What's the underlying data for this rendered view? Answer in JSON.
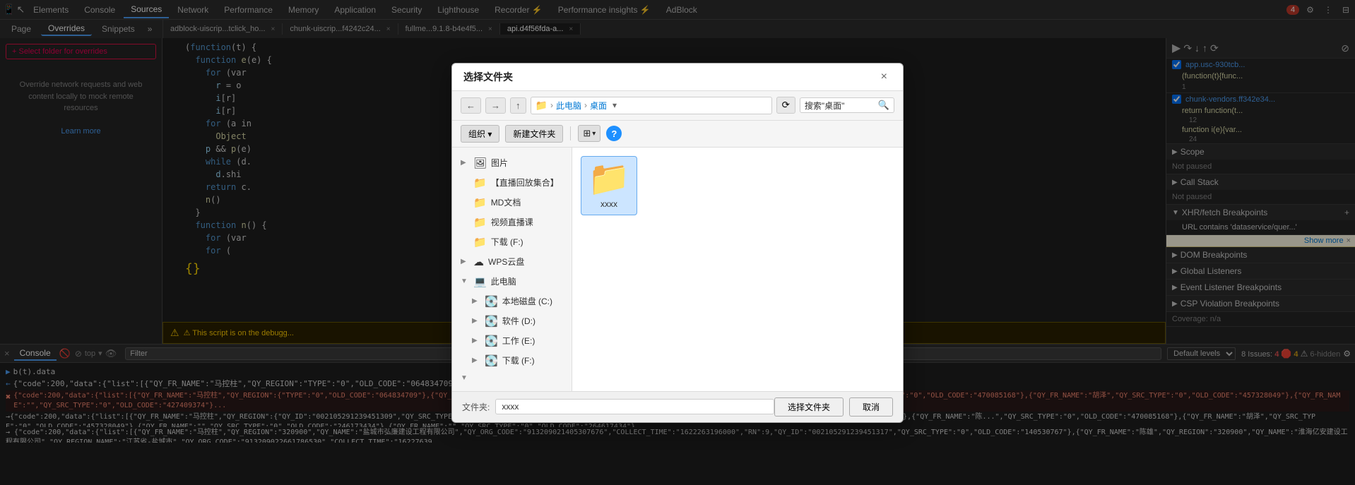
{
  "tabs": {
    "items": [
      {
        "label": "Elements",
        "active": false
      },
      {
        "label": "Console",
        "active": false
      },
      {
        "label": "Sources",
        "active": true
      },
      {
        "label": "Network",
        "active": false
      },
      {
        "label": "Performance",
        "active": false
      },
      {
        "label": "Memory",
        "active": false
      },
      {
        "label": "Application",
        "active": false
      },
      {
        "label": "Security",
        "active": false
      },
      {
        "label": "Lighthouse",
        "active": false
      },
      {
        "label": "Recorder ⚡",
        "active": false
      },
      {
        "label": "Performance insights ⚡",
        "active": false
      },
      {
        "label": "AdBlock",
        "active": false
      }
    ],
    "issue_count": "4",
    "settings_icon": "⚙",
    "more_icon": "⋮",
    "dock_icon": "⊟",
    "undock_icon": "⊞"
  },
  "subtabs": {
    "items": [
      {
        "label": "Page",
        "active": false
      },
      {
        "label": "Overrides",
        "active": true
      },
      {
        "label": "Snippets",
        "active": false
      }
    ],
    "more": "»",
    "menu_icon": "⋮"
  },
  "sidebar": {
    "select_folder_label": "+ Select folder for overrides",
    "info_text": "Override network requests and web content locally to mock remote resources",
    "learn_more": "Learn more"
  },
  "file_tabs": [
    {
      "label": "adblock-uiscrip...tclick_ho...",
      "active": false,
      "closable": true
    },
    {
      "label": "chunk-uiscrip...f4242c24...",
      "active": false,
      "closable": true
    },
    {
      "label": "fullme...9.1.8-b4e4f5...",
      "active": false,
      "closable": true
    },
    {
      "label": "api.d4f56fda-a...",
      "active": true,
      "closable": true
    }
  ],
  "code_lines": [
    {
      "num": "",
      "content": "(function(t) {"
    },
    {
      "num": "",
      "content": "  function e(e) {"
    },
    {
      "num": "",
      "content": "    for (var"
    },
    {
      "num": "",
      "content": "      r = o"
    },
    {
      "num": "",
      "content": "      i[r]"
    },
    {
      "num": "",
      "content": "      i[r]"
    },
    {
      "num": "",
      "content": "    for (a in"
    },
    {
      "num": "",
      "content": "      Object"
    },
    {
      "num": "",
      "content": "    p && p(e)"
    },
    {
      "num": "",
      "content": "    while (d."
    },
    {
      "num": "",
      "content": "      d.shi"
    },
    {
      "num": "",
      "content": "    return c."
    },
    {
      "num": "",
      "content": "    n()"
    },
    {
      "num": "",
      "content": "  }"
    },
    {
      "num": "",
      "content": "  function n() {"
    },
    {
      "num": "",
      "content": "    for (var"
    },
    {
      "num": "",
      "content": "    for ("
    }
  ],
  "debug_banner": "⚠ This script is on the debugg...",
  "right_panel": {
    "scope_label": "Scope",
    "scope_status": "Not paused",
    "callstack_label": "Call Stack",
    "callstack_status": "Not paused",
    "xhr_label": "XHR/fetch Breakpoints",
    "url_contains_label": "URL contains 'dataservice/quer...'",
    "dom_label": "DOM Breakpoints",
    "global_label": "Global Listeners",
    "event_label": "Event Listener Breakpoints",
    "csp_label": "CSP Violation Breakpoints",
    "file_items": [
      {
        "name": "app.usc-930tcb...",
        "checked": true,
        "line": 1,
        "fn": "(function(t){func..."
      },
      {
        "name": "chunk-vendors.ff342e34...",
        "checked": true,
        "lines": [
          12,
          24
        ]
      },
      {
        "fn1": "return function(t...",
        "line1": 12
      },
      {
        "fn2": "function i(e){var...",
        "line2": 24
      }
    ],
    "show_more": "Show more",
    "coverage": "Coverage: n/a"
  },
  "console": {
    "tab_label": "Console",
    "filter_placeholder": "Filter",
    "level_label": "Default levels",
    "issues_label": "8 Issues:",
    "issues_count": "4",
    "issues_warn": "4",
    "issues_hidden": "6-hidden",
    "line1": "b(t).data",
    "line2": "{\"code\":200,\"data\":{\"list\":[{\"QY_FR_NAME\":\"马控柱\",\"QY_REGION\":{\"TYPE\":\"0\",\"OLD_CODE\":\"064834709\"},{\"QY_FR_NAME\":\"郭伟其\",\"QY_REG...",
    "line3_red": "{\"code\":200,\"data\":{\"list\":[{\"QY_FR_NAME\":\"马控柱\",\"QY_REGION\":\"TYPE\":\"0\",\"OLD_CODE\":\"064834709\"},{\"QY_FR_NAME\":\"郭伟其\"...",
    "long_data": "→ {\"code\":200,\"data\":{\"list\":[{\"QY_FR_NAME\":\"马控柱\",\"QY_REGION\":{\"TYPE\":\"0\",\"OLD_CODE\":\"064834709\"},{\"QY_FR_NAME\":\"郭伟其\",\"QY_REG:\"425030769\"},{\"QY_FR_NAME\":\"陈...\",\"QY_SRC_TYPE\":\"0\",\"OLD_CODE\":\"470085168\"},{\"QY_FR_NAME\":\"\",\"QY_SRC_TYPE\":\"0\",\"OLD_CODE\":\"457328049\"},{\"QY_FR_NAME\":\"胡泽\",\"QY_SRC_TYPE\":\"0\",\"OLD_CODE\":\"427409374\"},{\"QY_FR_NAME\":\"元...\",\"QY_SRC_TYPE\":\"0\",\"OLD_CODE\":\"246173434\"},{\"QY_SRC_TYPE\":\"0\",\"OLD_CODE\":\"264617434\"},{\"QY_FR_NAME\":\""
  },
  "dialog": {
    "title": "选择文件夹",
    "close_btn": "×",
    "breadcrumb": [
      "此电脑",
      "桌面"
    ],
    "search_placeholder": "搜索\"桌面\"",
    "organize_label": "组织 ▾",
    "new_folder_label": "新建文件夹",
    "sidebar_items": [
      {
        "label": "图片",
        "icon": "🖼",
        "arrow": "▶",
        "indent": false
      },
      {
        "label": "【直播回放集合】",
        "icon": "📁",
        "arrow": "",
        "indent": false
      },
      {
        "label": "MD文档",
        "icon": "📁",
        "arrow": "",
        "indent": false
      },
      {
        "label": "视频直播课",
        "icon": "📁",
        "arrow": "",
        "indent": false
      },
      {
        "label": "下载 (F:)",
        "icon": "📁",
        "arrow": "",
        "indent": false
      },
      {
        "label": "WPS云盘",
        "icon": "☁",
        "arrow": "▶",
        "indent": false
      },
      {
        "label": "此电脑",
        "icon": "💻",
        "arrow": "▼",
        "indent": false
      },
      {
        "label": "本地磁盘 (C:)",
        "icon": "💽",
        "arrow": "▶",
        "indent": true
      },
      {
        "label": "软件 (D:)",
        "icon": "💽",
        "arrow": "▶",
        "indent": true
      },
      {
        "label": "工作 (E:)",
        "icon": "💽",
        "arrow": "▶",
        "indent": true
      },
      {
        "label": "下载 (F:)",
        "icon": "💽",
        "arrow": "▶",
        "indent": true
      },
      {
        "label": "",
        "icon": "",
        "arrow": "▼",
        "indent": false
      }
    ],
    "folder_item": {
      "name": "xxxx",
      "selected": true
    },
    "filename_label": "文件夹:",
    "filename_value": "xxxx",
    "select_btn": "选择文件夹",
    "cancel_btn": "取消"
  }
}
